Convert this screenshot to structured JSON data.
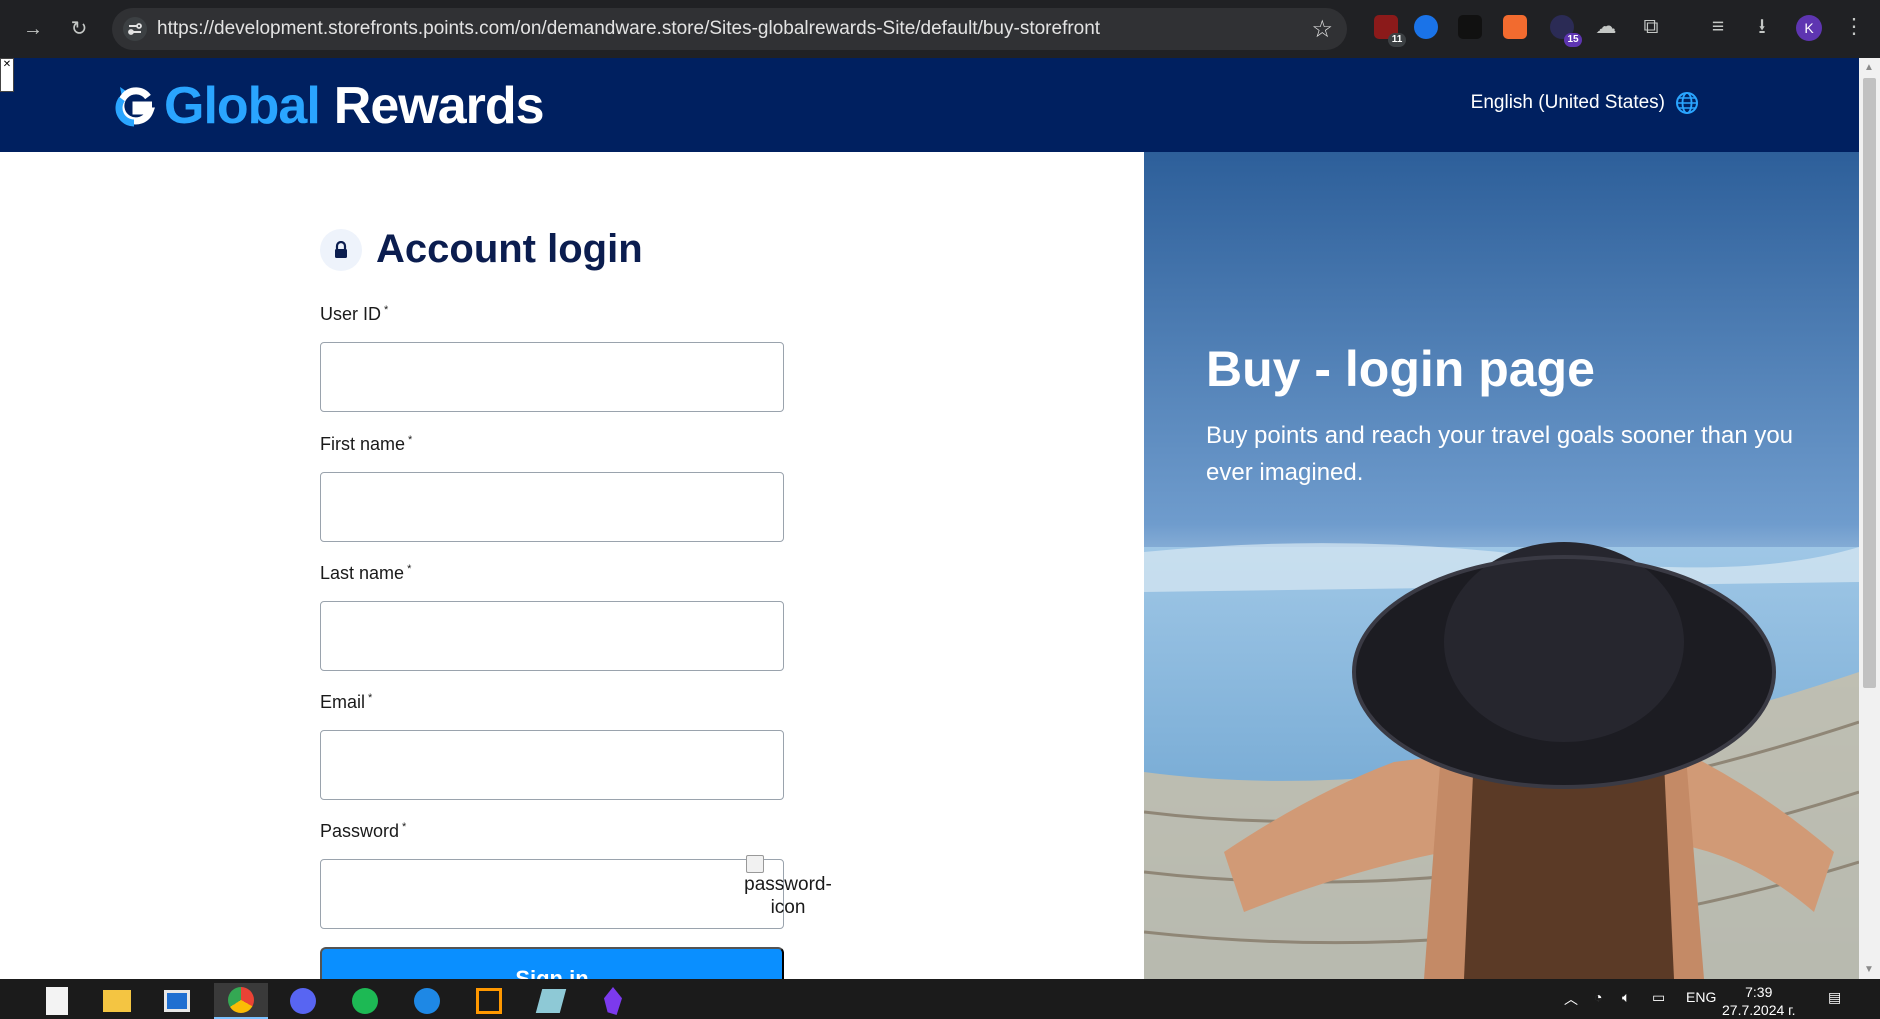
{
  "browser": {
    "url": "https://development.storefronts.points.com/on/demandware.store/Sites-globalrewards-Site/default/buy-storefront",
    "extension_badges": [
      "11",
      "15"
    ],
    "avatar_letter": "K",
    "icons": [
      "forward-icon",
      "reload-icon",
      "site-settings-icon",
      "star-icon",
      "extensions-icon",
      "reading-list-icon",
      "download-icon",
      "menu-icon"
    ]
  },
  "header": {
    "logo_global": "Global",
    "logo_rewards": "Rewards",
    "language": "English (United States)"
  },
  "login": {
    "title": "Account login",
    "fields": [
      {
        "label": "User ID",
        "required": "*",
        "value": ""
      },
      {
        "label": "First name",
        "required": "*",
        "value": ""
      },
      {
        "label": "Last name",
        "required": "*",
        "value": ""
      },
      {
        "label": "Email",
        "required": "*",
        "value": ""
      },
      {
        "label": "Password",
        "required": "*",
        "value": ""
      }
    ],
    "password_icon_alt": "password-icon",
    "submit_label": "Sign in"
  },
  "hero": {
    "title": "Buy - login page",
    "subtitle": "Buy points and reach your travel goals sooner than you ever imagined."
  },
  "taskbar": {
    "language": "ENG",
    "time": "7:39",
    "date": "27.7.2024 г."
  },
  "colors": {
    "header_bg": "#002060",
    "accent": "#0a8fff",
    "logo_blue": "#2aa5ff",
    "title_navy": "#0b1d4f"
  }
}
